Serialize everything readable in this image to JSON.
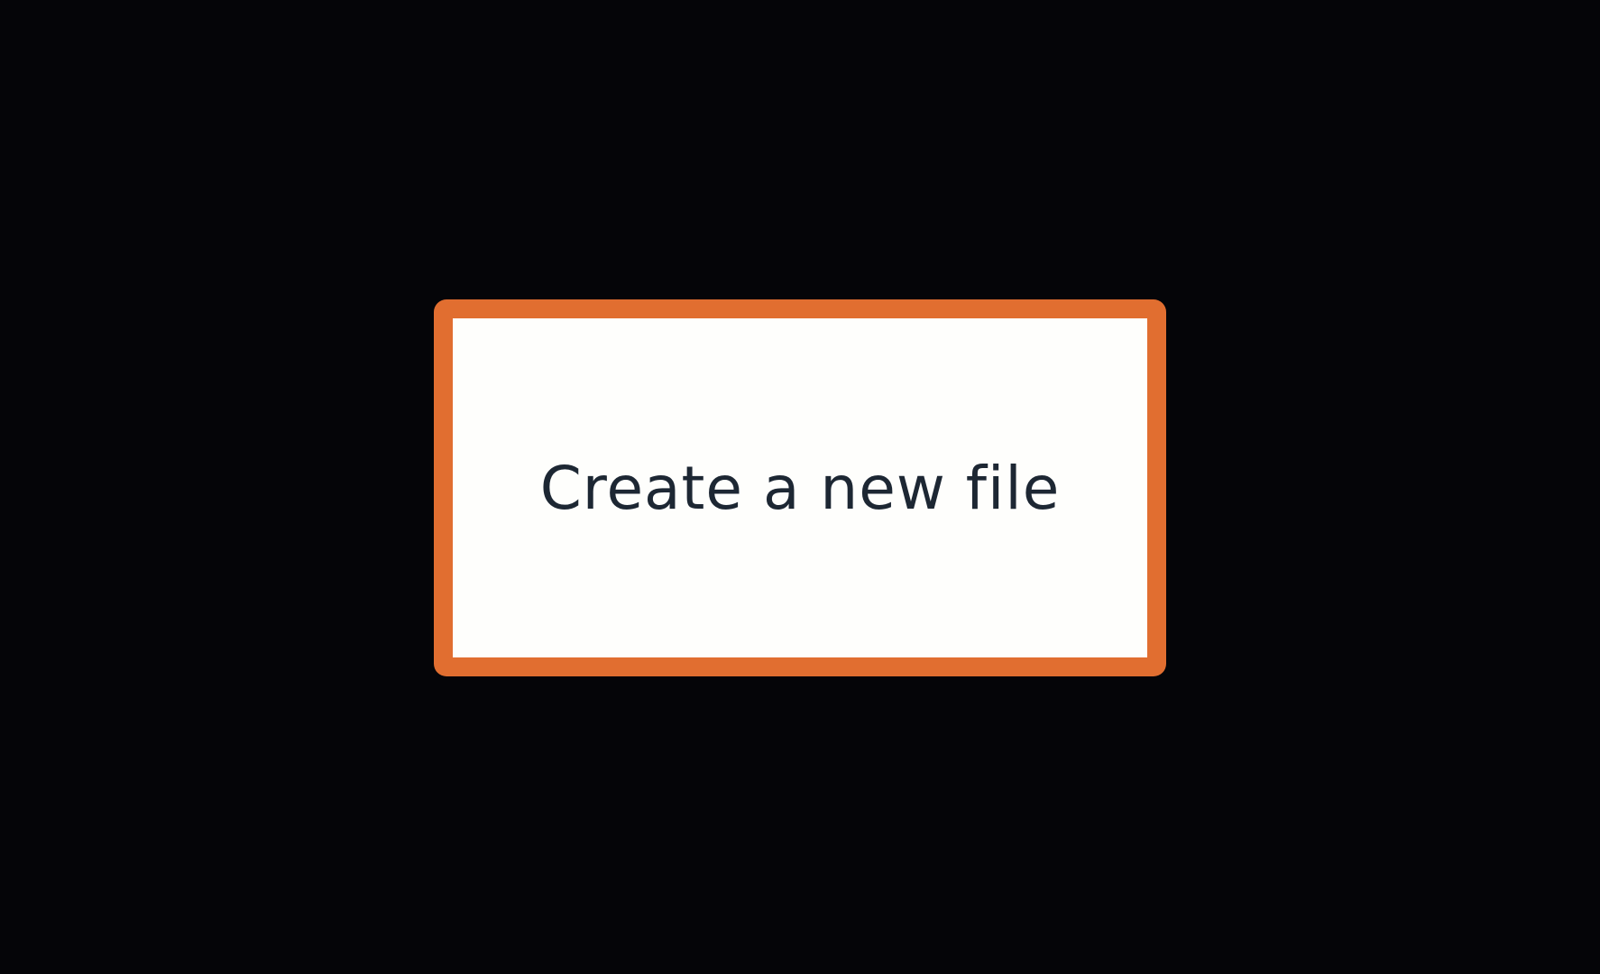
{
  "colors": {
    "background": "#050508",
    "card_border": "#e16e30",
    "card_fill": "#fefefc",
    "label_text": "#1d2733"
  },
  "create_file": {
    "label": "Create a new file"
  }
}
